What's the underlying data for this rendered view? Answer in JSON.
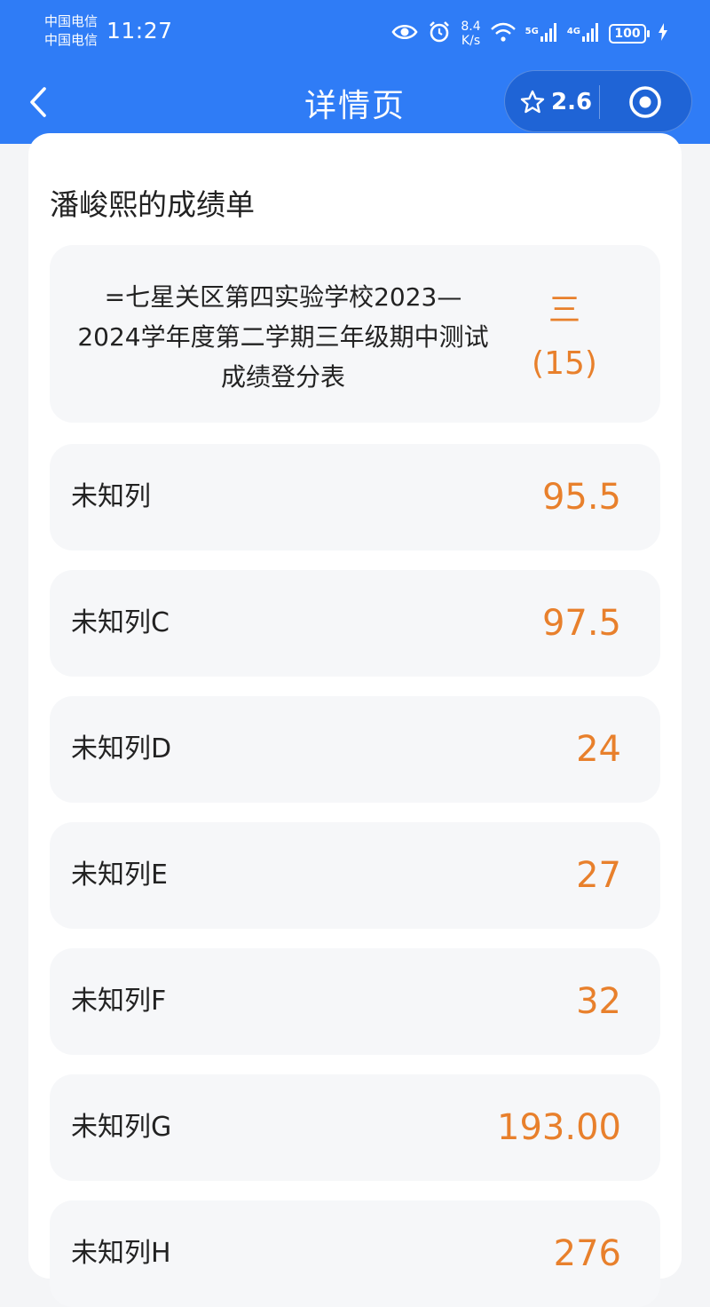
{
  "status_bar": {
    "carrier_1": "中国电信",
    "carrier_2": "中国电信",
    "time": "11:27",
    "speed_value": "8.4",
    "speed_unit": "K/s",
    "net_type_1": "5G",
    "net_type_2": "4G",
    "battery": "100",
    "icons": [
      "eye-icon",
      "alarm-icon",
      "wifi-icon",
      "signal-icon",
      "signal-icon",
      "battery-icon",
      "charging-icon"
    ]
  },
  "nav": {
    "title": "详情页",
    "rating": "2.6",
    "icons": [
      "back-chevron-icon",
      "star-icon",
      "target-icon"
    ]
  },
  "card": {
    "title": "潘峻熙的成绩单",
    "exam": {
      "name": "=七星关区第四实验学校2023—2024学年度第二学期三年级期中测试成绩登分表",
      "grade": "三",
      "class": "(15)"
    },
    "rows": [
      {
        "label": "未知列",
        "value": "95.5"
      },
      {
        "label": "未知列C",
        "value": "97.5"
      },
      {
        "label": "未知列D",
        "value": "24"
      },
      {
        "label": "未知列E",
        "value": "27"
      },
      {
        "label": "未知列F",
        "value": "32"
      },
      {
        "label": "未知列G",
        "value": "193.00"
      },
      {
        "label": "未知列H",
        "value": "276"
      }
    ]
  },
  "colors": {
    "header_bg": "#2f7cf6",
    "capsule_bg": "#1f64d6",
    "accent_orange": "#e8802c",
    "row_bg": "#f6f7f9"
  }
}
